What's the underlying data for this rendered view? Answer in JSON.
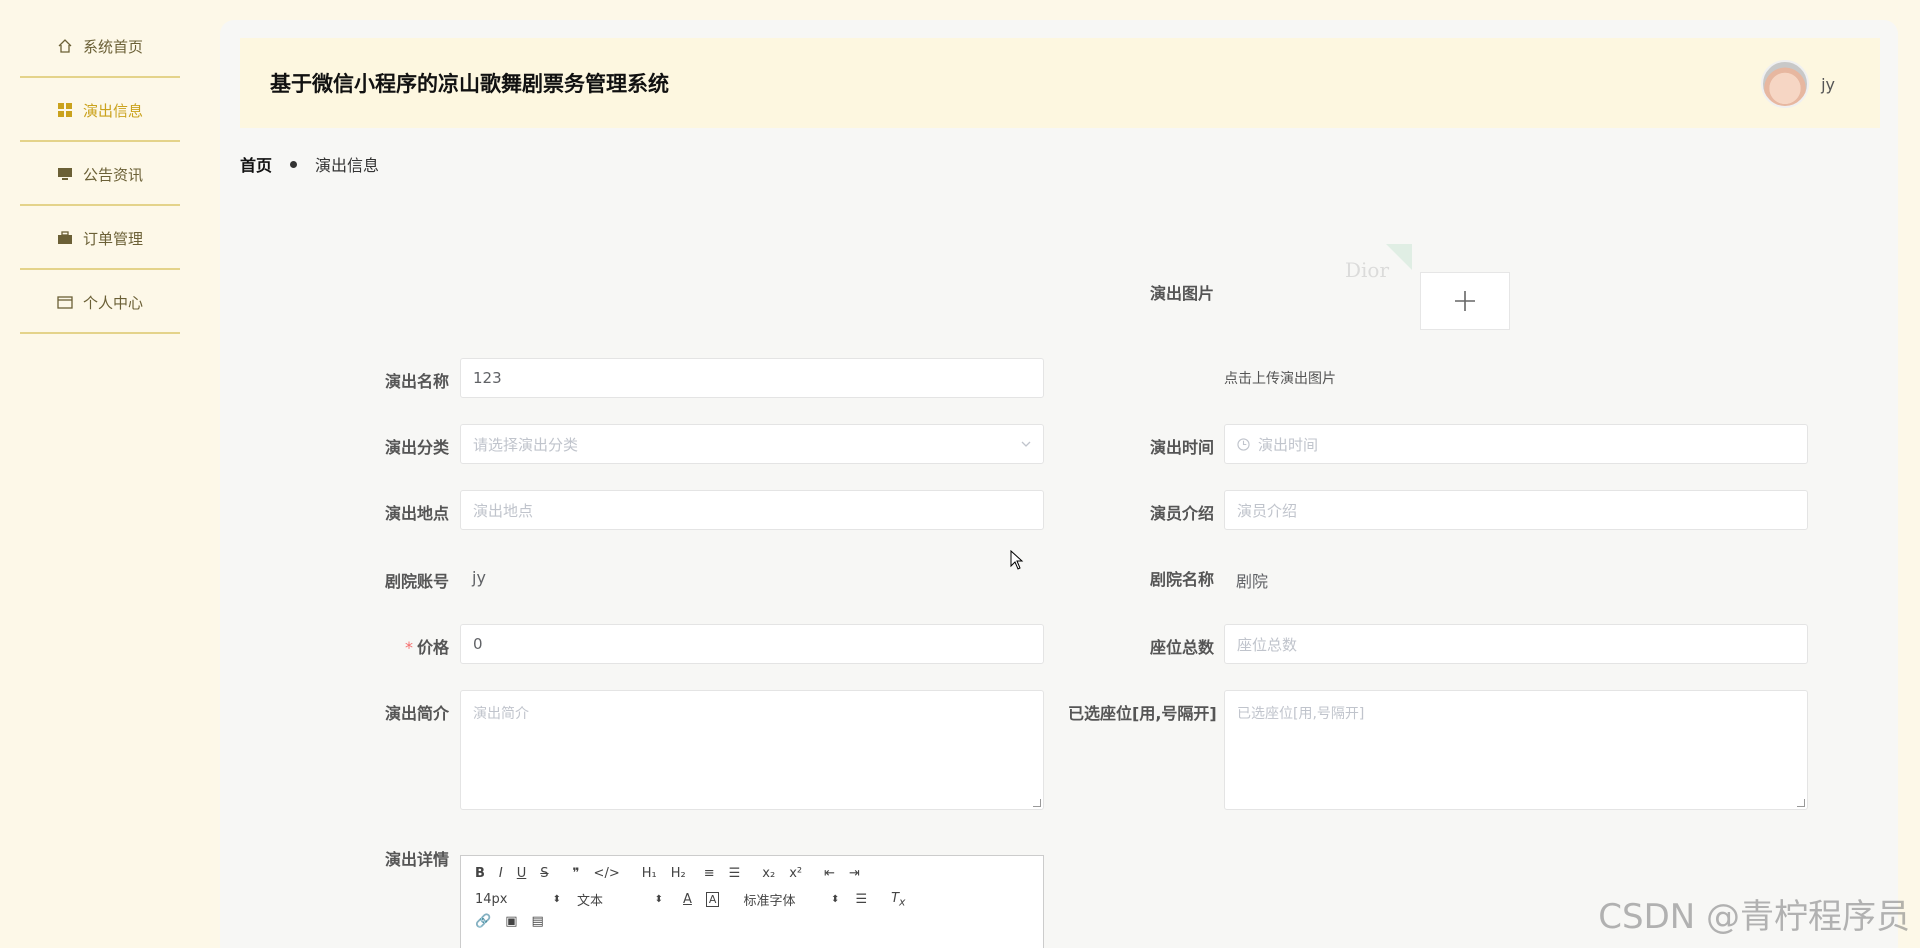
{
  "sidebar": {
    "items": [
      {
        "label": "系统首页",
        "icon": "home-icon"
      },
      {
        "label": "演出信息",
        "icon": "grid-icon",
        "active": true
      },
      {
        "label": "公告资讯",
        "icon": "monitor-icon"
      },
      {
        "label": "订单管理",
        "icon": "briefcase-icon"
      },
      {
        "label": "个人中心",
        "icon": "wallet-icon"
      }
    ]
  },
  "header": {
    "title": "基于微信小程序的凉山歌舞剧票务管理系统",
    "username": "jy"
  },
  "breadcrumb": {
    "home": "首页",
    "current": "演出信息"
  },
  "form": {
    "image_label": "演出图片",
    "image_thumb_text": "Dior",
    "upload_tip": "点击上传演出图片",
    "name_label": "演出名称",
    "name_value": "123",
    "category_label": "演出分类",
    "category_placeholder": "请选择演出分类",
    "time_label": "演出时间",
    "time_placeholder": "演出时间",
    "location_label": "演出地点",
    "location_placeholder": "演出地点",
    "actor_label": "演员介绍",
    "actor_placeholder": "演员介绍",
    "theater_account_label": "剧院账号",
    "theater_account_value": "jy",
    "theater_name_label": "剧院名称",
    "theater_name_value": "剧院",
    "price_required_mark": "*",
    "price_label": "价格",
    "price_value": "0",
    "seats_label": "座位总数",
    "seats_placeholder": "座位总数",
    "intro_label": "演出简介",
    "intro_placeholder": "演出简介",
    "selected_seats_label": "已选座位[用,号隔开]",
    "selected_seats_placeholder": "已选座位[用,号隔开]",
    "detail_label": "演出详情"
  },
  "editor": {
    "row1": [
      "B",
      "I",
      "U",
      "S",
      "❞",
      "</>",
      "H₁",
      "H₂",
      "≡",
      "☰",
      "x₂",
      "x²",
      "⇤",
      "⇥"
    ],
    "font_size": "14px",
    "text_type": "文本",
    "font_family": "标准字体"
  },
  "watermark": "CSDN @青柠程序员"
}
